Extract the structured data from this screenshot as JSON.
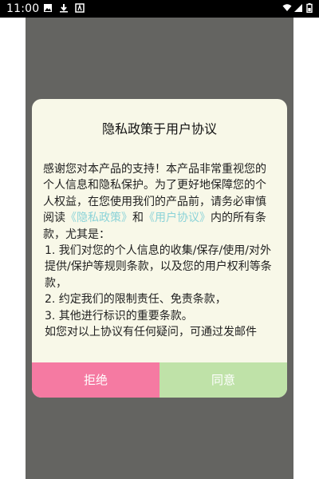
{
  "status_bar": {
    "time": "11:00",
    "icons": [
      "image-notification-icon",
      "download-notification-icon",
      "app-notification-icon",
      "wifi-icon",
      "signal-icon",
      "battery-icon"
    ]
  },
  "colors": {
    "screen_overlay": "#646461",
    "dialog_background": "#f8f8e8",
    "link": "#8bd3d8",
    "reject_button": "#f57aa2",
    "agree_button": "#bfe2a8"
  },
  "dialog": {
    "title": "隐私政策于用户协议",
    "intro_prefix": "感谢您对本产品的支持！本产品非常重视您的个人信息和隐私保护。为了更好地保障您的个人权益，在您使用我们的产品前，请务必审慎阅读",
    "privacy_link": "《隐私政策》",
    "and_text": "和",
    "user_agreement_link": "《用户协议》",
    "intro_suffix": "内的所有条款，尤其是：",
    "items": [
      "1. 我们对您的个人信息的收集/保存/使用/对外提供/保护等规则条款，以及您的用户权利等条款，",
      "2. 约定我们的限制责任、免责条款，",
      "3. 其他进行标识的重要条款。"
    ],
    "contact_text": "如您对以上协议有任何疑问，可通过发邮件",
    "reject_label": "拒绝",
    "agree_label": "同意"
  }
}
